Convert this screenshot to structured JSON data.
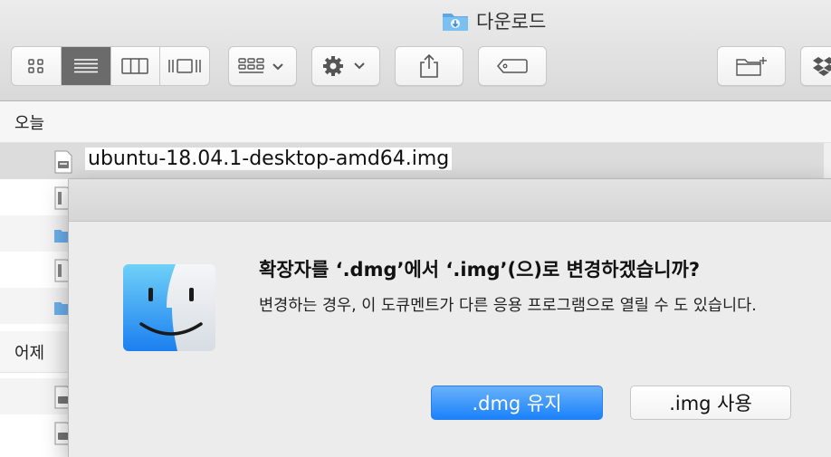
{
  "window": {
    "title": "다운로드",
    "folder_icon": "downloads-folder-icon"
  },
  "toolbar": {
    "view_buttons": [
      "icon-view",
      "list-view",
      "column-view",
      "cover-flow-view"
    ],
    "active_view": "list-view",
    "buttons": [
      "group-by",
      "action-gear",
      "share",
      "tag",
      "new-folder",
      "dropbox"
    ]
  },
  "sections": {
    "today": "오늘",
    "yesterday": "어제"
  },
  "files": {
    "selected": "ubuntu-18.04.1-desktop-amd64.img"
  },
  "dialog": {
    "title": "확장자를 ‘.dmg’에서 ‘.img’(으)로 변경하겠습니까?",
    "message": "변경하는 경우, 이 도큐멘트가 다른 응용 프로그램으로 열릴 수 도 있습니다.",
    "keep_button": ".dmg 유지",
    "use_button": ".img 사용",
    "icon": "finder-icon"
  },
  "colors": {
    "primary_button": "#1a82fb",
    "dialog_bg": "#ececec"
  }
}
